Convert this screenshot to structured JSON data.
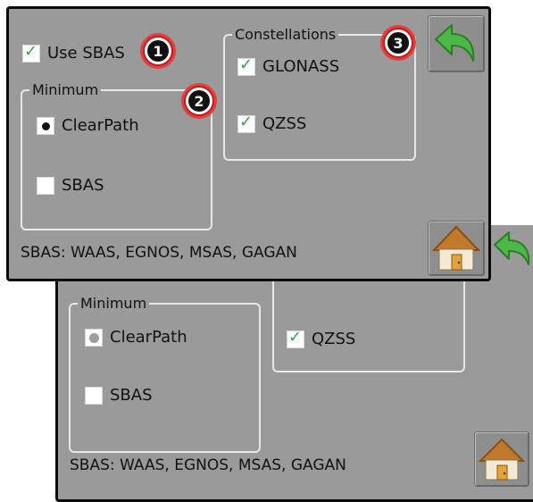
{
  "front": {
    "use_sbas_label": "Use SBAS",
    "minimum": {
      "legend": "Minimum",
      "options": [
        {
          "label": "ClearPath",
          "selected": true
        },
        {
          "label": "SBAS",
          "selected": false
        }
      ]
    },
    "constellations": {
      "legend": "Constellations",
      "items": [
        {
          "label": "GLONASS",
          "checked": true
        },
        {
          "label": "QZSS",
          "checked": true
        }
      ]
    },
    "status_text": "SBAS: WAAS, EGNOS, MSAS, GAGAN",
    "callouts": [
      "1",
      "2",
      "3"
    ]
  },
  "back": {
    "minimum": {
      "legend": "Minimum",
      "options": [
        {
          "label": "ClearPath",
          "selected": true,
          "disabled": true
        },
        {
          "label": "SBAS",
          "selected": false
        }
      ]
    },
    "constellations": {
      "items": [
        {
          "label": "QZSS",
          "checked": true
        }
      ]
    },
    "status_text": "SBAS: WAAS, EGNOS, MSAS, GAGAN"
  },
  "colors": {
    "panel_bg": "#9a9a9a",
    "check_green": "#34a845",
    "back_arrow_green": "#4cb848",
    "home_roof": "#c07a2c",
    "callout_red": "#c41c1c"
  },
  "icons": {
    "back": "back-arrow-icon",
    "home": "home-icon",
    "check": "checkmark-icon"
  }
}
